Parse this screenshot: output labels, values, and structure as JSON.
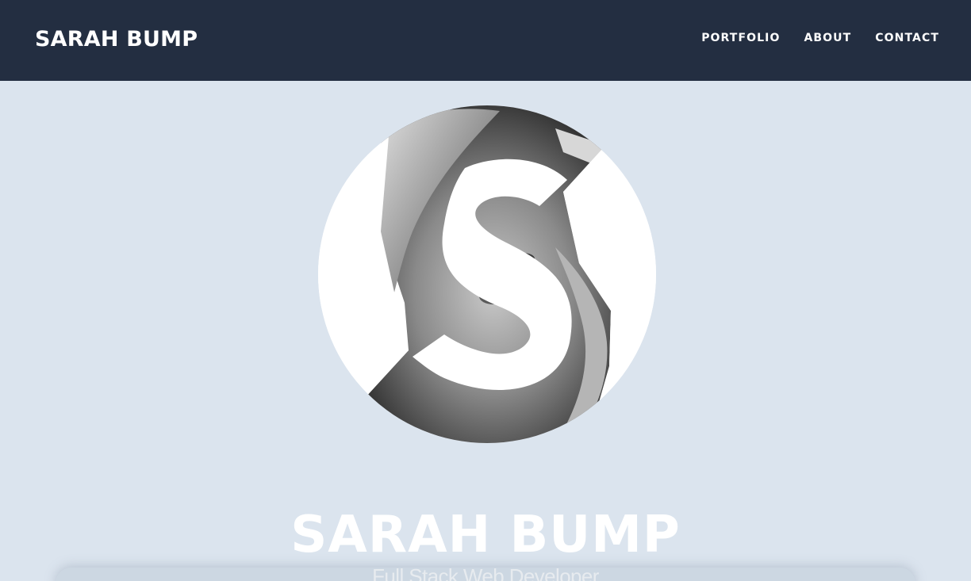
{
  "navbar": {
    "brand": "SARAH BUMP",
    "links": [
      {
        "label": "PORTFOLIO"
      },
      {
        "label": "ABOUT"
      },
      {
        "label": "CONTACT"
      }
    ]
  },
  "hero": {
    "title": "SARAH BUMP",
    "subtitle": "Full Stack Web Developer",
    "avatar_icon": "s-monogram-photo-icon"
  },
  "colors": {
    "navbar_bg": "#232e41",
    "page_bg": "#dbe4ee",
    "text": "#ffffff"
  }
}
